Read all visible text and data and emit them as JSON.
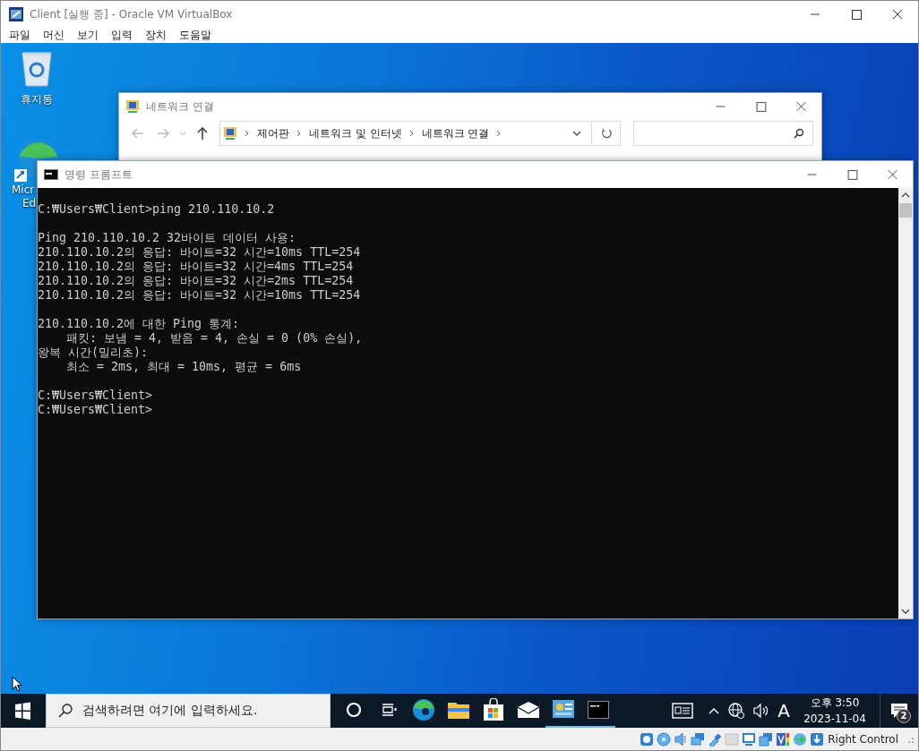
{
  "host_window": {
    "title": "Client [실행 중] - Oracle VM VirtualBox",
    "menu": [
      "파일",
      "머신",
      "보기",
      "입력",
      "장치",
      "도움말"
    ]
  },
  "desktop_icons": [
    {
      "kind": "recycle-bin",
      "label_lines": [
        "휴지통"
      ]
    },
    {
      "kind": "edge",
      "label_lines": [
        "Micr",
        "Ed"
      ]
    }
  ],
  "explorer_window": {
    "title": "네트워크 연결",
    "breadcrumbs": [
      "제어판",
      "네트워크 및 인터넷",
      "네트워크 연결"
    ]
  },
  "cmd_window": {
    "title": "명령 프롬프트",
    "output_blocks": [
      [
        "C:₩Users₩Client>ping 210.110.10.2"
      ],
      [
        "Ping 210.110.10.2 32바이트 데이터 사용:",
        "210.110.10.2의 응답: 바이트=32 시간=10ms TTL=254",
        "210.110.10.2의 응답: 바이트=32 시간=4ms TTL=254",
        "210.110.10.2의 응답: 바이트=32 시간=2ms TTL=254",
        "210.110.10.2의 응답: 바이트=32 시간=10ms TTL=254"
      ],
      [
        "210.110.10.2에 대한 Ping 통계:",
        "    패킷: 보냄 = 4, 받음 = 4, 손실 = 0 (0% 손실),",
        "왕복 시간(밀리초):",
        "    최소 = 2ms, 최대 = 10ms, 평균 = 6ms"
      ],
      [
        "C:₩Users₩Client>",
        "C:₩Users₩Client>"
      ]
    ]
  },
  "taskbar": {
    "search_placeholder": "검색하려면 여기에 입력하세요.",
    "apps": [
      {
        "kind": "cortana",
        "running": false
      },
      {
        "kind": "task-view",
        "running": false
      },
      {
        "kind": "edge",
        "running": false
      },
      {
        "kind": "file-explorer",
        "running": false
      },
      {
        "kind": "store",
        "running": false
      },
      {
        "kind": "mail",
        "running": false
      },
      {
        "kind": "control-panel",
        "running": true
      },
      {
        "kind": "command-prompt",
        "running": true
      }
    ],
    "input_indicator": "A",
    "time": "오후 3:50",
    "date": "2023-11-04",
    "notification_count": "2"
  },
  "status_bar": {
    "host_key": "Right Control"
  }
}
